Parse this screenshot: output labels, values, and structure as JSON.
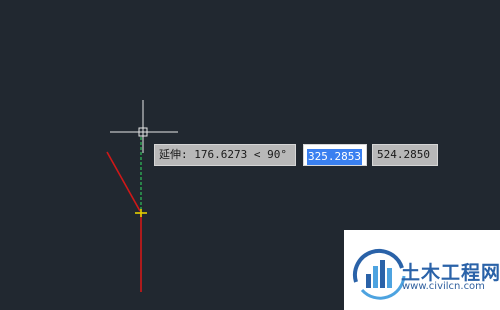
{
  "cad": {
    "command_tooltip": "延伸: 176.6273 < 90°",
    "length_input": "325.2853",
    "secondary_value": "524.2850"
  },
  "watermark": {
    "title": "土木工程网",
    "url": "www.civilcn.com"
  },
  "colors": {
    "canvas_bg": "#212830",
    "line_red": "#d01818",
    "extension_green": "#2fc25a",
    "marker_yellow": "#e6d000",
    "selection_blue": "#3a80f0",
    "logo_blue": "#2a62a8"
  },
  "icons": {
    "crosshair": "crosshair-cursor-icon",
    "endpoint": "endpoint-snap-icon",
    "logo": "civilcn-logo-icon"
  }
}
